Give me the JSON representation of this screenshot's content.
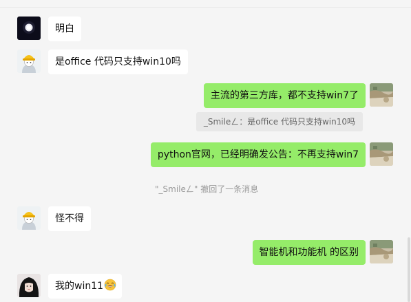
{
  "messages": [
    {
      "side": "left",
      "sender": "night-moon",
      "text": "明白"
    },
    {
      "side": "left",
      "sender": "cartoon-hat",
      "text": "是office 代码只支持win10吗"
    },
    {
      "side": "right",
      "sender": "self",
      "text": "主流的第三方库，都不支持win7了"
    },
    {
      "quote": "_Smileㄥ：是office 代码只支持win10吗"
    },
    {
      "side": "right",
      "sender": "self",
      "text": "python官网，已经明确发公告：不再支持win7"
    },
    {
      "system": "\"_Smileㄥ\" 撤回了一条消息"
    },
    {
      "side": "left",
      "sender": "cartoon-hat",
      "text": "怪不得"
    },
    {
      "side": "right",
      "sender": "self",
      "text": "智能机和功能机 的区别"
    },
    {
      "side": "left",
      "sender": "dark-hair-girl",
      "text": "我的win11",
      "emoji": "face-with-tears-of-joy"
    }
  ],
  "colors": {
    "background": "#f5f5f5",
    "left_bubble": "#ffffff",
    "right_bubble": "#95ec69",
    "quote_bg": "#e8e8e8",
    "system_text": "#999999"
  }
}
